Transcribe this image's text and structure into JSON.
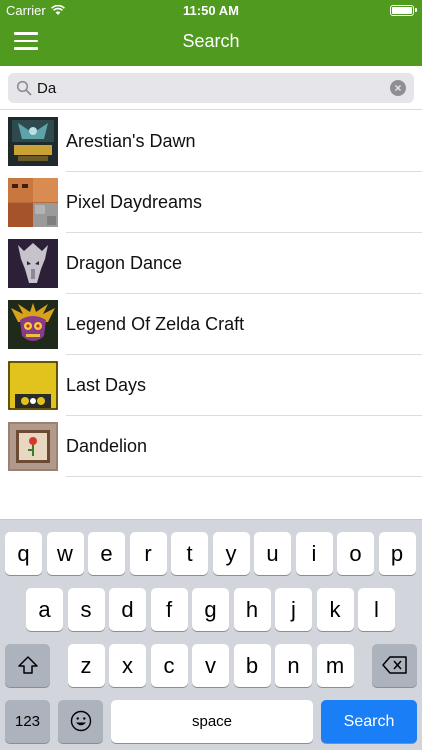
{
  "status_bar": {
    "carrier": "Carrier",
    "time": "11:50 AM"
  },
  "nav": {
    "title": "Search",
    "menu_icon": "hamburger-menu-icon"
  },
  "search": {
    "value": "Da",
    "placeholder": ""
  },
  "results": [
    {
      "title": "Arestian's Dawn"
    },
    {
      "title": "Pixel Daydreams"
    },
    {
      "title": "Dragon Dance"
    },
    {
      "title": "Legend Of Zelda Craft"
    },
    {
      "title": "Last Days",
      "thumb_text": "LAST DAYS"
    },
    {
      "title": "Dandelion"
    }
  ],
  "keyboard": {
    "row1": [
      "q",
      "w",
      "e",
      "r",
      "t",
      "y",
      "u",
      "i",
      "o",
      "p"
    ],
    "row2": [
      "a",
      "s",
      "d",
      "f",
      "g",
      "h",
      "j",
      "k",
      "l"
    ],
    "row3": [
      "z",
      "x",
      "c",
      "v",
      "b",
      "n",
      "m"
    ],
    "numbers_label": "123",
    "space_label": "space",
    "search_label": "Search"
  },
  "colors": {
    "nav_green": "#4f9a1f",
    "search_key_blue": "#1a7ef7",
    "keyboard_bg": "#d2d5db"
  }
}
